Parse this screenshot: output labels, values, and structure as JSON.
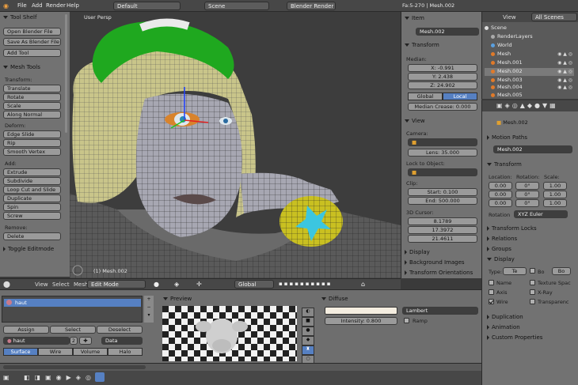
{
  "topbar": {
    "menus": [
      "File",
      "Add",
      "Render",
      "Help"
    ],
    "screen": "Default",
    "scene": "Scene",
    "engine": "Blender Render",
    "stats": "Fa:5-270 | Mesh.002"
  },
  "toolshelf": {
    "title": "Tool Shelf",
    "buttons": [
      "Open Blender File",
      "Save As Blender File",
      "Add Tool"
    ],
    "mesh_tools_title": "Mesh Tools",
    "transform_label": "Transform:",
    "transform": [
      "Translate",
      "Rotate",
      "Scale",
      "Along Normal"
    ],
    "deform_label": "Deform:",
    "deform": [
      "Edge Slide",
      "Rip",
      "Smooth Vertex"
    ],
    "add_label": "Add:",
    "add": [
      "Extrude",
      "Subdivide",
      "Loop Cut and Slide",
      "Duplicate",
      "Spin",
      "Screw"
    ],
    "remove_label": "Remove:",
    "remove": [
      "Delete"
    ],
    "toggle_editmode": "Toggle Editmode"
  },
  "viewport": {
    "label": "User Persp",
    "object_label": "(1) Mesh.002"
  },
  "view3d_header": {
    "menus": [
      "View",
      "Select",
      "Mesh"
    ],
    "mode": "Edit Mode",
    "orientation": "Global"
  },
  "properties_panel": {
    "item_title": "Item",
    "item_name": "Mesh.002",
    "transform_title": "Transform",
    "median_label": "Median:",
    "x": "X: -0.991",
    "y": "Y: 2.438",
    "z": "Z: 24.902",
    "global_tab": "Global",
    "local_tab": "Local",
    "median_crease": "Median Crease: 0.000",
    "view_title": "View",
    "camera_label": "Camera:",
    "lens": "Lens: 35.000",
    "lock_label": "Lock to Object:",
    "clip_label": "Clip:",
    "clip_start": "Start: 0.100",
    "clip_end": "End: 500.000",
    "cursor_label": "3D Cursor:",
    "cursor_x": "8.1789",
    "cursor_y": "17.3972",
    "cursor_z": "21.4611",
    "display_title": "Display",
    "bg_images_title": "Background Images",
    "orientations_title": "Transform Orientations"
  },
  "outliner": {
    "view_menu": "View",
    "scenes_select": "All Scenes",
    "rows": [
      "Scene",
      "RenderLayers",
      "World",
      "Mesh",
      "Mesh.001",
      "Mesh.002",
      "Mesh.003",
      "Mesh.004",
      "Mesh.005"
    ]
  },
  "object_props": {
    "object_name": "Mesh.002",
    "motion_paths": "Motion Paths",
    "object_field": "Mesh.002",
    "transform_title": "Transform",
    "location_label": "Location:",
    "rotation_label": "Rotation:",
    "scale_label": "Scale:",
    "loc": [
      "0.00",
      "0.00",
      "0.00"
    ],
    "rot": [
      "0°",
      "0°",
      "0°"
    ],
    "scale": [
      "1.00",
      "1.00",
      "1.00"
    ],
    "rotation_mode_label": "Rotation",
    "rotation_mode": "XYZ Euler",
    "transform_locks": "Transform Locks",
    "relations": "Relations",
    "groups": "Groups",
    "display_title": "Display",
    "type_label": "Type:",
    "type_value": "Te",
    "bo_label": "Bo",
    "bo_value": "Bo",
    "checks": {
      "name": "Name",
      "axis": "Axis",
      "wire": "Wire",
      "texture_space": "Texture Spac",
      "x_ray": "X-Ray",
      "transparency": "Transparenc"
    },
    "duplication": "Duplication",
    "animation": "Animation",
    "custom_properties": "Custom Properties"
  },
  "material": {
    "slot_name": "haut",
    "assign": "Assign",
    "select": "Select",
    "deselect": "Deselect",
    "mat_name": "haut",
    "users": "2",
    "data": "Data",
    "tabs": [
      "Surface",
      "Wire",
      "Volume",
      "Halo"
    ],
    "preview_title": "Preview",
    "diffuse_title": "Diffuse",
    "shader": "Lambert",
    "intensity": "Intensity: 0.800",
    "ramp": "Ramp"
  },
  "colors": {
    "accent": "#5680c2",
    "panel": "#727272",
    "header": "#474747"
  }
}
